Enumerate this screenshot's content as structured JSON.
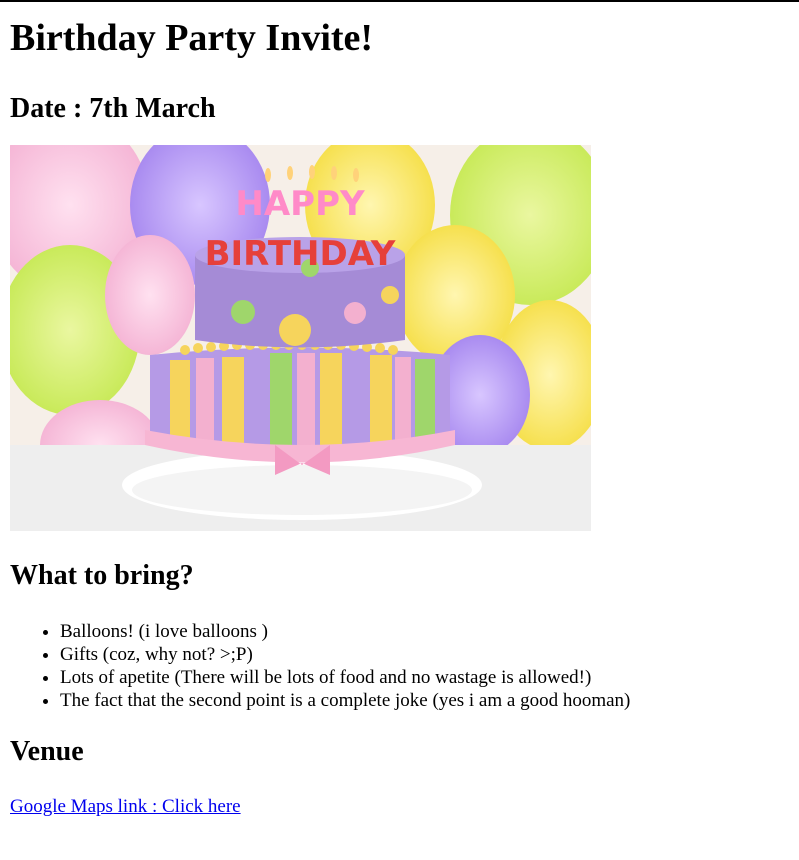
{
  "page": {
    "title": "Birthday Party Invite!",
    "date": "Date : 7th March",
    "image": {
      "semantic": "birthday-cake-photo",
      "caption_text": "HAPPY BIRTHDAY"
    },
    "bring_heading": "What to bring?",
    "bring_items": [
      "Balloons! (i love balloons )",
      "Gifts (coz, why not? >;P)",
      "Lots of apetite (There will be lots of food and no wastage is allowed!)",
      "The fact that the second point is a complete joke (yes i am a good hooman)"
    ],
    "venue_heading": "Venue",
    "maps_link": "Google Maps link : Click here"
  },
  "colors": {
    "link": "#0000ee",
    "cake_purple": "#a58bd6",
    "cake_pink": "#f3a6c6",
    "cake_yellow": "#f4d35e",
    "cake_green": "#9ccc65"
  }
}
